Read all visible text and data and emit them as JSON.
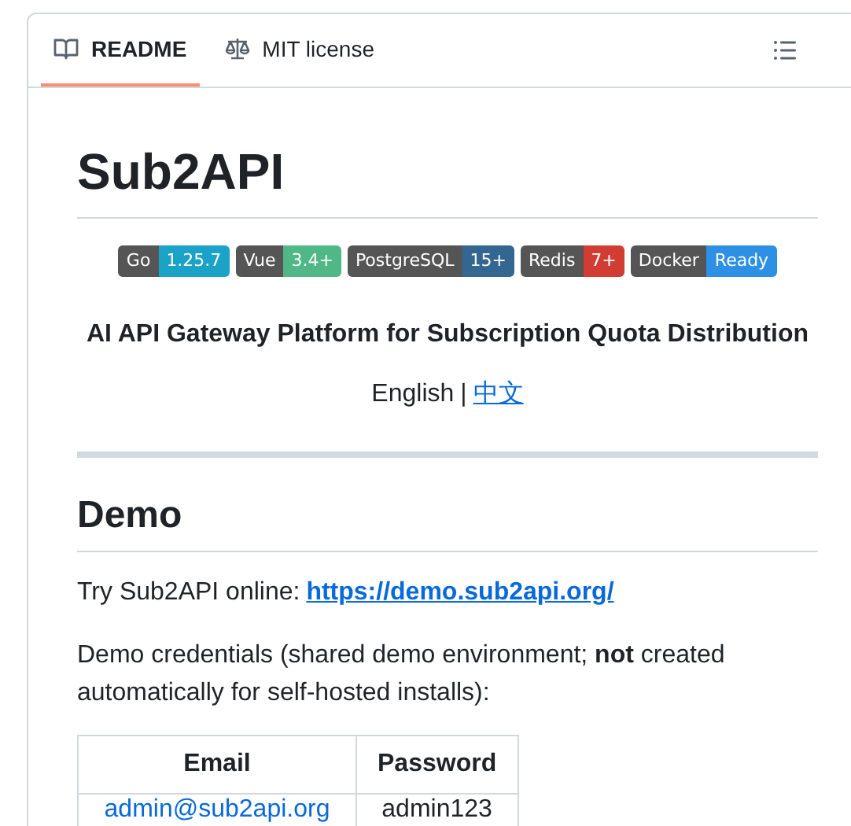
{
  "tabs": [
    {
      "label": "README",
      "selected": true
    },
    {
      "label": "MIT license",
      "selected": false
    }
  ],
  "title": "Sub2API",
  "badges": [
    {
      "label": "Go",
      "value": "1.25.7",
      "color": "#1aa2c7"
    },
    {
      "label": "Vue",
      "value": "3.4+",
      "color": "#4fb886"
    },
    {
      "label": "PostgreSQL",
      "value": "15+",
      "color": "#336791"
    },
    {
      "label": "Redis",
      "value": "7+",
      "color": "#d13d32"
    },
    {
      "label": "Docker",
      "value": "Ready",
      "color": "#2d90e5"
    }
  ],
  "tagline": "AI API Gateway Platform for Subscription Quota Distribution",
  "languages": {
    "current": "English",
    "separator": "|",
    "link": "中文"
  },
  "demo": {
    "heading": "Demo",
    "try_text": "Try Sub2API online:",
    "try_link": "https://demo.sub2api.org/",
    "credentials_text": "Demo credentials (shared demo environment; **not** created automatically for self-hosted installs):",
    "table": {
      "columns": [
        "Email",
        "Password"
      ],
      "rows": [
        [
          "admin@sub2api.org",
          "admin123"
        ]
      ]
    }
  }
}
